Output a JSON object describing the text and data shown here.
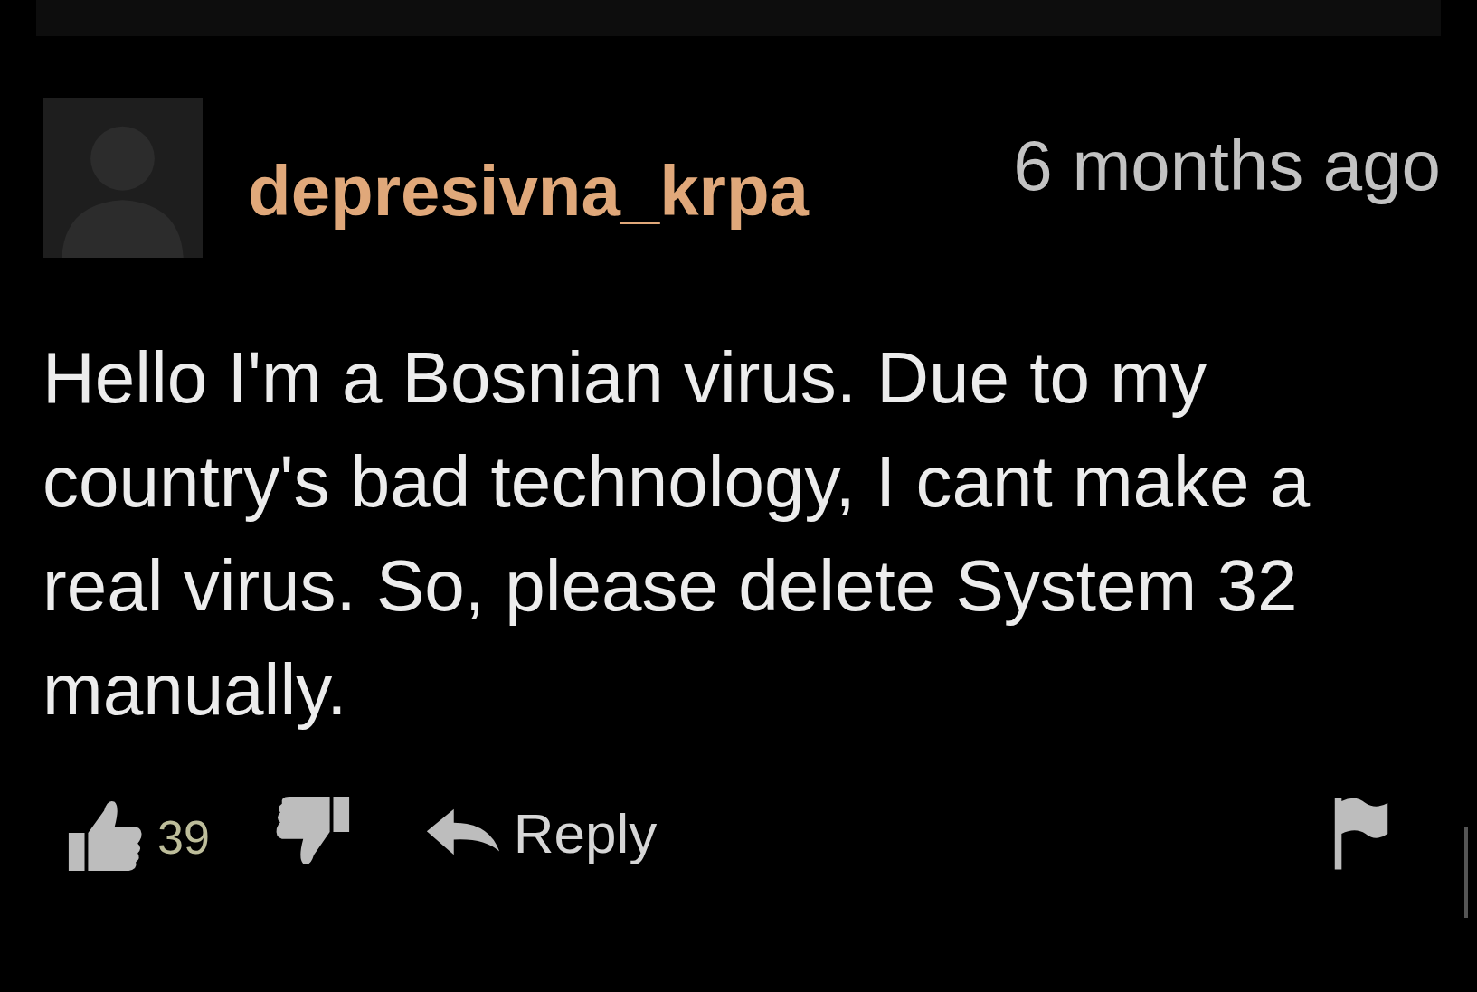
{
  "comment": {
    "username": "depresivna_krpa",
    "time": "6 months ago",
    "text": "Hello I'm a Bosnian virus. Due to my country's bad technology, I cant make a real virus. So, please delete System 32 manually.",
    "likes": "39",
    "reply_label": "Reply"
  }
}
